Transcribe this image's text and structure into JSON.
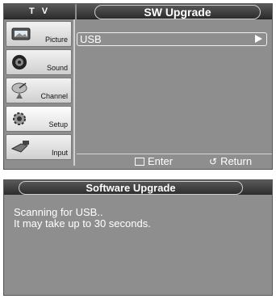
{
  "menu": {
    "tv_label": "T V",
    "title": "SW Upgrade",
    "sidebar": [
      {
        "label": "Picture",
        "icon": "picture-icon"
      },
      {
        "label": "Sound",
        "icon": "sound-icon"
      },
      {
        "label": "Channel",
        "icon": "channel-icon"
      },
      {
        "label": "Setup",
        "icon": "setup-icon"
      },
      {
        "label": "Input",
        "icon": "input-icon"
      }
    ],
    "active_item": "Setup",
    "option": {
      "label": "USB"
    },
    "footer": {
      "enter_label": "Enter",
      "return_label": "Return"
    }
  },
  "dialog": {
    "title": "Software Upgrade",
    "line1": "Scanning for USB..",
    "line2": "It may take up to 30 seconds."
  },
  "colors": {
    "panel": "#8e8e8e",
    "header": "#2c2c2c",
    "text": "#ffffff"
  }
}
